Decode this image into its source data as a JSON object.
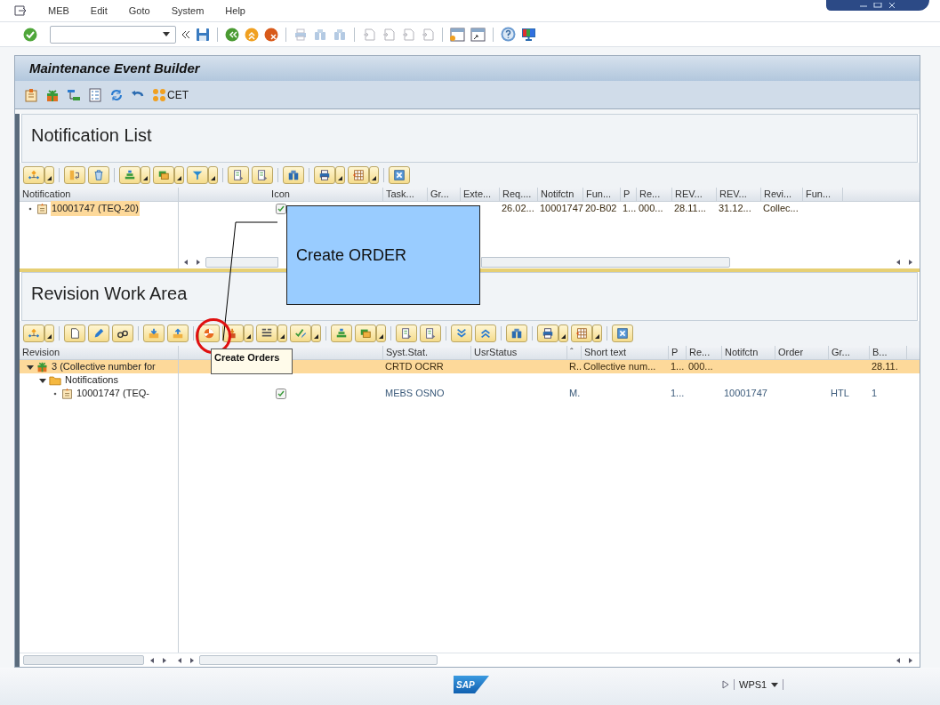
{
  "menu": [
    "MEB",
    "Edit",
    "Goto",
    "System",
    "Help"
  ],
  "title": "Maintenance Event Builder",
  "app_toolbar": {
    "cet_label": "CET"
  },
  "notification_list": {
    "title": "Notification List",
    "columns": [
      "Notification",
      "Icon",
      "Task...",
      "Gr...",
      "Exte...",
      "Req....",
      "Notifctn",
      "Fun...",
      "P",
      "Re...",
      "REV...",
      "REV...",
      "Revi...",
      "Fun..."
    ],
    "rows": [
      {
        "kind": "notification",
        "label": "10001747 (TEQ-20)",
        "selected": true,
        "status_icon": true,
        "cells": [
          "",
          "",
          "",
          "",
          "",
          "26.02...",
          "10001747",
          "20-B02",
          "1...",
          "000...",
          "28.11...",
          "31.12...",
          "Collec..."
        ]
      }
    ]
  },
  "revision_work_area": {
    "title": "Revision Work Area",
    "columns": [
      "Revision",
      null,
      "Syst.Stat.",
      "UsrStatus",
      "ˆ",
      "Short text",
      "P",
      "Re...",
      "Notifctn",
      "Order",
      "Gr...",
      "B..."
    ],
    "rows": [
      {
        "kind": "revision",
        "label": "3 (Collective number for",
        "selected": true,
        "expanded": true,
        "status_icon": false,
        "cells": [
          "",
          "",
          "CRTD OCRR",
          "",
          "R..",
          "Collective num...",
          "1...",
          "000...",
          "",
          "",
          "",
          "28.11."
        ],
        "children": [
          {
            "kind": "folder",
            "label": "Notifications",
            "selected": false,
            "expanded": true,
            "status_icon": false,
            "children": [
              {
                "kind": "notification",
                "label": "10001747 (TEQ-",
                "selected": false,
                "status_icon": true,
                "cells": [
                  "",
                  "",
                  "MEBS OSNO",
                  "",
                  "M.",
                  "",
                  "1...",
                  "",
                  "10001747",
                  "",
                  "HTL",
                  "1"
                ]
              }
            ]
          }
        ]
      }
    ]
  },
  "callout": {
    "text": "Create ORDER"
  },
  "tooltip": {
    "text": "Create Orders"
  },
  "status_bar": {
    "logo": "SAP",
    "system": "WPS1"
  }
}
